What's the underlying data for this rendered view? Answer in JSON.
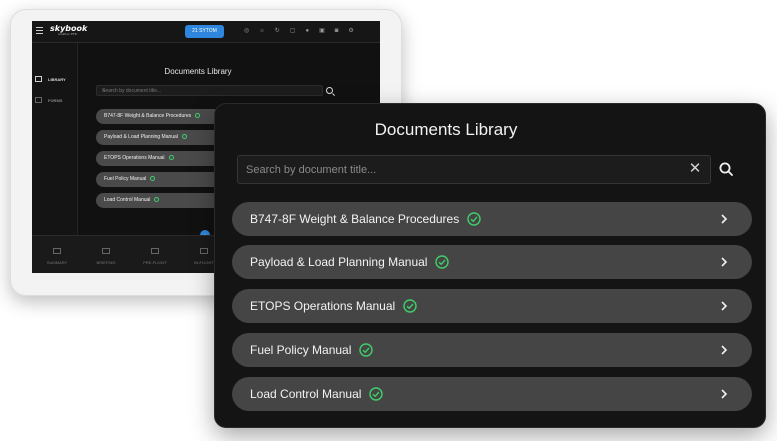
{
  "app": {
    "logo": "skybook",
    "logo_tagline": "Aviation EFB",
    "header_pill": "21 SYTOM"
  },
  "sidebar": {
    "items": [
      {
        "label": "LIBRARY",
        "icon": "library-icon",
        "active": true
      },
      {
        "label": "FORMS",
        "icon": "forms-icon",
        "active": false
      }
    ]
  },
  "library": {
    "title": "Documents Library",
    "search_placeholder": "Search by document title...",
    "documents": [
      {
        "title": "B747-8F Weight & Balance Procedures",
        "status": "check-circle-icon"
      },
      {
        "title": "Payload & Load Planning Manual",
        "status": "check-circle-icon"
      },
      {
        "title": "ETOPS Operations Manual",
        "status": "check-circle-icon"
      },
      {
        "title": "Fuel Policy Manual",
        "status": "check-circle-icon"
      },
      {
        "title": "Load Control Manual",
        "status": "check-circle-icon"
      }
    ]
  },
  "bottom_nav": {
    "tabs": [
      {
        "label": "SUMMARY",
        "icon": "summary-icon"
      },
      {
        "label": "BRIEFING",
        "icon": "briefing-icon"
      },
      {
        "label": "PRE-FLIGHT",
        "icon": "preflight-icon"
      },
      {
        "label": "IN-FLIGHT",
        "icon": "inflight-icon"
      }
    ]
  },
  "colors": {
    "accent": "#2f86dd",
    "check": "#3fcf6a",
    "row_background": "#454546",
    "panel_background": "#141415"
  }
}
